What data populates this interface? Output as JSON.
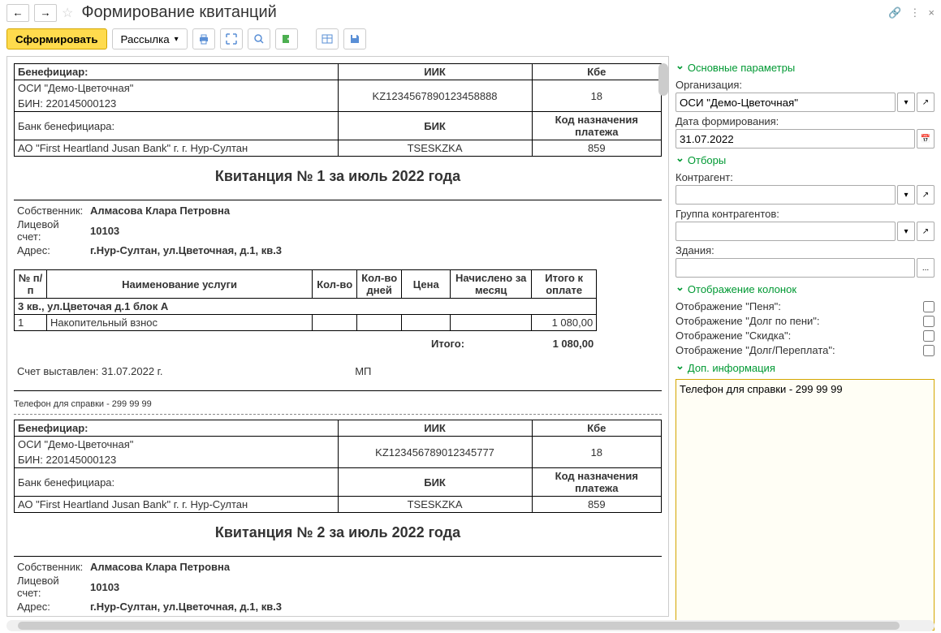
{
  "title": "Формирование квитанций",
  "toolbar": {
    "generate": "Сформировать",
    "mailing": "Рассылка"
  },
  "receipts": [
    {
      "beneficiary_label": "Бенефициар:",
      "beneficiary_name": "ОСИ \"Демо-Цветочная\"",
      "bin": "БИН: 220145000123",
      "iik_label": "ИИК",
      "iik_value": "KZ1234567890123458888",
      "kbe_label": "Кбе",
      "kbe_value": "18",
      "bank_label": "Банк бенефициара:",
      "bank_name": "АО \"First Heartland Jusan Bank\" г. г. Нур-Султан",
      "bik_label": "БИК",
      "bik_value": "TSESKZKA",
      "purpose_label": "Код назначения платежа",
      "purpose_value": "859",
      "receipt_title": "Квитанция № 1 за июль 2022 года",
      "owner_label": "Собственник:",
      "owner_name": "Алмасова Клара Петровна",
      "account_label": "Лицевой счет:",
      "account_value": "10103",
      "address_label": "Адрес:",
      "address_value": "г.Нур-Султан, ул.Цветочная, д.1, кв.3",
      "headers": {
        "num": "№ п/п",
        "service": "Наименование услуги",
        "qty": "Кол-во",
        "days": "Кол-во дней",
        "price": "Цена",
        "month": "Начислено за месяц",
        "total": "Итого к оплате"
      },
      "section": "3 кв., ул.Цветочая д.1 блок А",
      "row": {
        "num": "1",
        "name": "Накопительный взнос",
        "total": "1 080,00"
      },
      "total_label": "Итого:",
      "total_value": "1 080,00",
      "issued": "Счет выставлен: 31.07.2022 г.",
      "mp": "МП",
      "phone": "Телефон для справки - 299 99 99"
    },
    {
      "beneficiary_label": "Бенефициар:",
      "beneficiary_name": "ОСИ \"Демо-Цветочная\"",
      "bin": "БИН: 220145000123",
      "iik_label": "ИИК",
      "iik_value": "KZ123456789012345777",
      "kbe_label": "Кбе",
      "kbe_value": "18",
      "bank_label": "Банк бенефициара:",
      "bank_name": "АО \"First Heartland Jusan Bank\" г. г. Нур-Султан",
      "bik_label": "БИК",
      "bik_value": "TSESKZKA",
      "purpose_label": "Код назначения платежа",
      "purpose_value": "859",
      "receipt_title": "Квитанция № 2 за июль 2022 года",
      "owner_label": "Собственник:",
      "owner_name": "Алмасова Клара Петровна",
      "account_label": "Лицевой счет:",
      "account_value": "10103",
      "address_label": "Адрес:",
      "address_value": "г.Нур-Султан, ул.Цветочная, д.1, кв.3"
    }
  ],
  "sidebar": {
    "section_main": "Основные параметры",
    "org_label": "Организация:",
    "org_value": "ОСИ \"Демо-Цветочная\"",
    "date_label": "Дата формирования:",
    "date_value": "31.07.2022",
    "section_filters": "Отборы",
    "counterparty_label": "Контрагент:",
    "group_label": "Группа контрагентов:",
    "buildings_label": "Здания:",
    "section_columns": "Отображение колонок",
    "col_penalty": "Отображение \"Пеня\":",
    "col_debt_penalty": "Отображение \"Долг по пени\":",
    "col_discount": "Отображение \"Скидка\":",
    "col_debt_overpay": "Отображение \"Долг/Переплата\":",
    "section_info": "Доп. информация",
    "info_text": "Телефон для справки - 299 99 99"
  }
}
